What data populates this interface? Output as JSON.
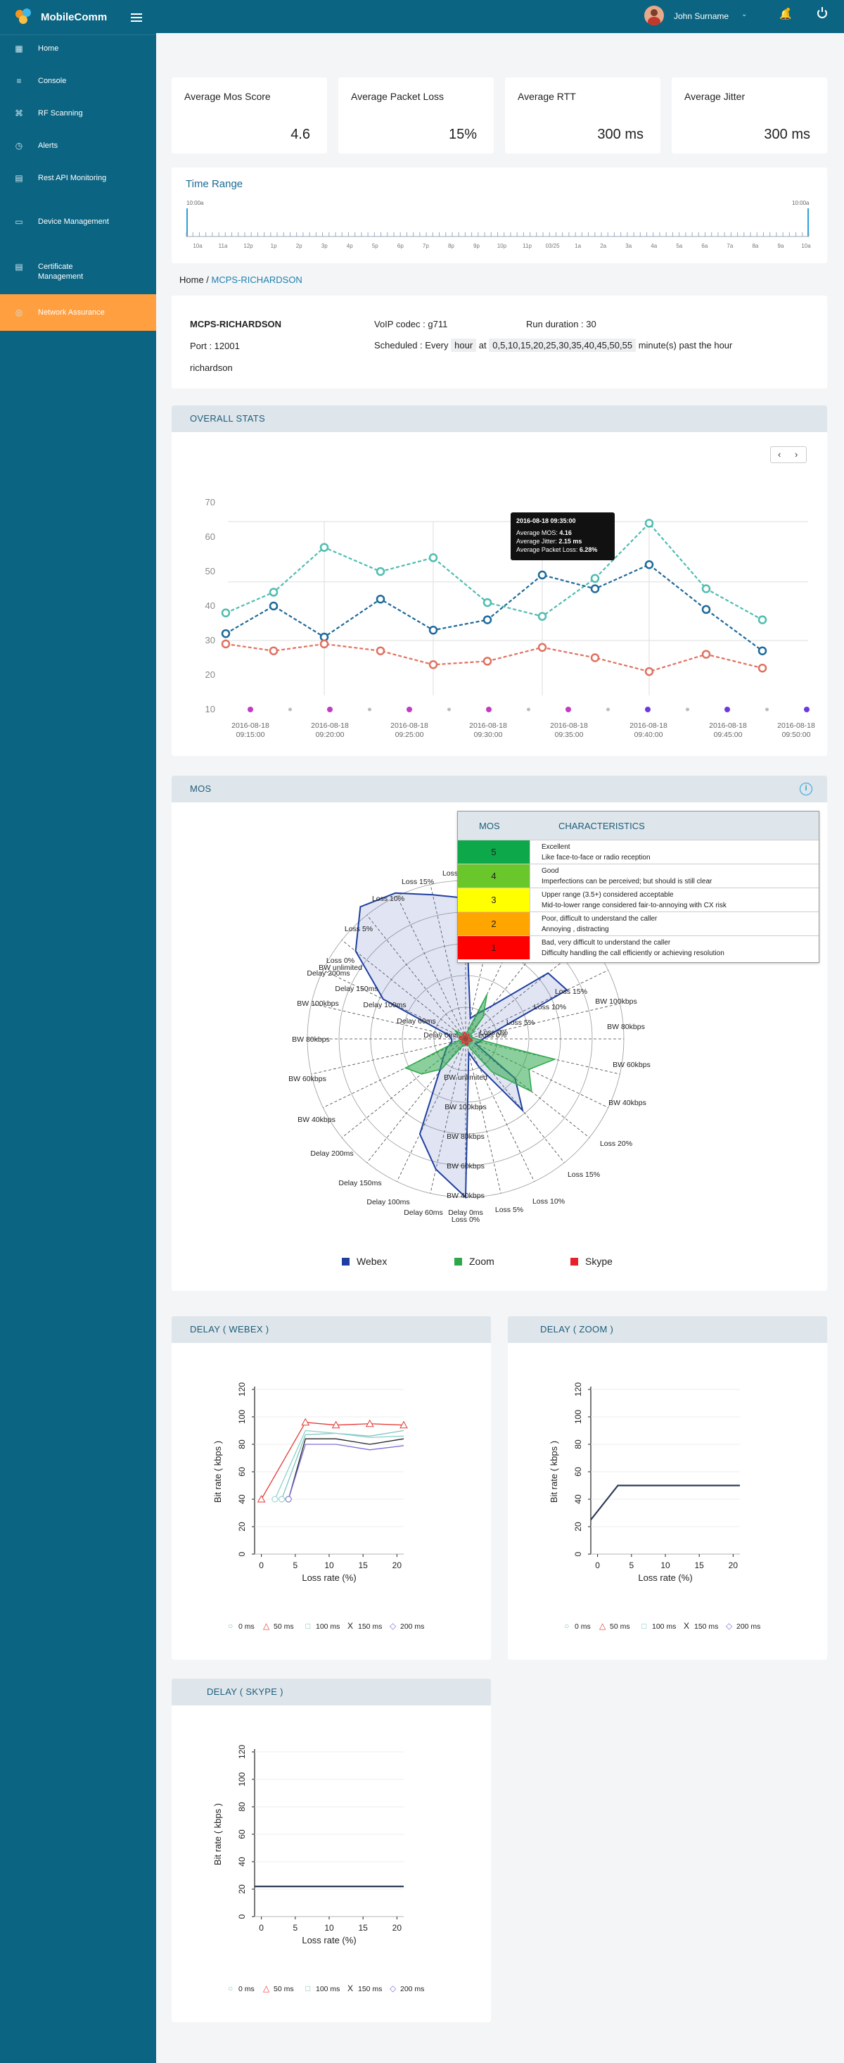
{
  "app": {
    "name": "MobileComm"
  },
  "sidebar": {
    "items": [
      {
        "label": "Home",
        "icon": "dashboard-icon"
      },
      {
        "label": "Console",
        "icon": "sliders-icon"
      },
      {
        "label": "RF Scanning",
        "icon": "tools-icon"
      },
      {
        "label": "Alerts",
        "icon": "clock-icon"
      },
      {
        "label": "Rest API Monitoring",
        "icon": "api-icon"
      },
      {
        "label": "Device Management",
        "icon": "device-icon"
      },
      {
        "label": "Certificate Management",
        "icon": "certificate-icon"
      },
      {
        "label": "Network Assurance",
        "icon": "network-icon"
      }
    ]
  },
  "topbar": {
    "user": "John Surname"
  },
  "kpis": [
    {
      "label": "Average Mos Score",
      "value": "4.6"
    },
    {
      "label": "Average Packet Loss",
      "value": "15%"
    },
    {
      "label": "Average RTT",
      "value": "300 ms"
    },
    {
      "label": "Average Jitter",
      "value": "300 ms"
    }
  ],
  "timerange": {
    "title": "Time Range",
    "start": "10:00a",
    "end": "10:00a",
    "ticks": [
      "10a",
      "11a",
      "12p",
      "1p",
      "2p",
      "3p",
      "4p",
      "5p",
      "6p",
      "7p",
      "8p",
      "9p",
      "10p",
      "11p",
      "03/25",
      "1a",
      "2a",
      "3a",
      "4a",
      "5a",
      "6a",
      "7a",
      "8a",
      "9a",
      "10a"
    ]
  },
  "breadcrumb": {
    "home": "Home",
    "current": "MCPS-RICHARDSON"
  },
  "info": {
    "name": "MCPS-RICHARDSON",
    "port": "Port : 12001",
    "location": "richardson",
    "codec": "VoIP codec : g711",
    "run": "Run duration : 30",
    "sched_prefix": "Scheduled : Every",
    "sched_unit": "hour",
    "sched_at": "at",
    "sched_minutes": "0,5,10,15,20,25,30,35,40,45,50,55",
    "sched_suffix": "minute(s) past the hour"
  },
  "overall": {
    "title": "OVERALL STATS",
    "tooltip": {
      "time": "2016-08-18    09:35:00",
      "mos_label": "Average MOS:",
      "mos": "4.16",
      "jitter_label": "Average Jitter:",
      "jitter": "2.15 ms",
      "loss_label": "Average Packet Loss:",
      "loss": "6.28%"
    }
  },
  "mos": {
    "title": "MOS",
    "col1": "MOS",
    "col2": "CHARACTERISTICS",
    "rows": [
      {
        "score": "5",
        "color": "#0ca84a",
        "l1": "Excellent",
        "l2": "Like face-to-face or radio reception"
      },
      {
        "score": "4",
        "color": "#6ac72b",
        "l1": "Good",
        "l2": "Imperfections can be perceived; but should is still  clear"
      },
      {
        "score": "3",
        "color": "#ffff00",
        "l1": "Upper range (3.5+) considered acceptable",
        "l2": "Mid-to-lower range considered fair-to-annoying with CX risk"
      },
      {
        "score": "2",
        "color": "#ffa500",
        "l1": "Poor, difficult to understand the caller",
        "l2": "Annoying , distracting"
      },
      {
        "score": "1",
        "color": "#ff0000",
        "l1": "Bad, very difficult to understand the caller",
        "l2": "Difficulty handling the call efficiently or achieving resolution"
      }
    ],
    "legend": [
      {
        "name": "Webex",
        "color": "#1f3fa0"
      },
      {
        "name": "Zoom",
        "color": "#2ca84a"
      },
      {
        "name": "Skype",
        "color": "#e8202a"
      }
    ]
  },
  "delay_panels": {
    "webex": "DELAY ( WEBEX )",
    "zoom": "DELAY ( ZOOM )",
    "skype": "DELAY ( SKYPE )",
    "xlabel": "Loss rate (%)",
    "ylabel": "Bit rate ( kbps )",
    "legend": [
      "0 ms",
      "50 ms",
      "100 ms",
      "150 ms",
      "200 ms"
    ]
  },
  "chart_data": [
    {
      "type": "line",
      "x": [
        "2016-08-18 09:15:00",
        "2016-08-18 09:20:00",
        "2016-08-18 09:25:00",
        "2016-08-18 09:30:00",
        "2016-08-18 09:35:00",
        "2016-08-18 09:40:00",
        "2016-08-18 09:45:00",
        "2016-08-18 09:50:00"
      ],
      "ylim": [
        10,
        70
      ],
      "yticks": [
        10,
        20,
        30,
        40,
        50,
        60,
        70
      ],
      "series": [
        {
          "color": "#4fbdb0",
          "values": [
            38,
            44,
            57,
            50,
            54,
            41,
            37,
            48,
            64,
            45,
            36
          ]
        },
        {
          "color": "#1d6a9a",
          "values": [
            32,
            40,
            31,
            42,
            33,
            36,
            49,
            45,
            52,
            39,
            27
          ]
        },
        {
          "color": "#e07160",
          "values": [
            29,
            27,
            29,
            27,
            23,
            24,
            28,
            25,
            21,
            26,
            22
          ]
        }
      ],
      "pts_x": [
        0,
        1,
        2,
        3,
        4,
        5,
        6,
        7,
        8,
        9,
        10
      ]
    },
    {
      "type": "radar",
      "axes": [
        "Loss 0%",
        "Loss 5%",
        "Loss 10%",
        "Loss 15%",
        "Loss 20%",
        "BW 100kbps",
        "BW 80kbps",
        "BW 60kbps",
        "BW 40kbps",
        "Delay 200ms",
        "Delay 150ms",
        "Delay 100ms",
        "Delay 60ms",
        "Delay 0ms",
        "Loss 0%",
        "Loss 5%",
        "Loss 10%",
        "Loss 15%",
        "Loss 20%",
        "BW 100kbps",
        "BW 80kbps",
        "BW 60kbps",
        "BW 40kbps",
        "Delay 200ms",
        "Delay 150ms",
        "Delay 100ms",
        "Delay 60ms",
        "Delay 0ms"
      ],
      "series": [
        {
          "name": "Webex"
        },
        {
          "name": "Zoom"
        },
        {
          "name": "Skype"
        }
      ]
    },
    {
      "type": "line",
      "title": "DELAY ( WEBEX )",
      "x": [
        0,
        2,
        3,
        4,
        6.5,
        11,
        16,
        21
      ],
      "ylim": [
        0,
        120
      ],
      "xlim": [
        -1,
        21
      ],
      "series": [
        {
          "name": "0 ms",
          "values": [
            null,
            null,
            40,
            null,
            87,
            88,
            86,
            90
          ]
        },
        {
          "name": "50 ms",
          "values": [
            40,
            null,
            null,
            null,
            96,
            94,
            95,
            94
          ]
        },
        {
          "name": "100 ms",
          "values": [
            null,
            40,
            null,
            null,
            90,
            88,
            85,
            86
          ]
        },
        {
          "name": "150 ms",
          "values": [
            null,
            null,
            null,
            40,
            84,
            84,
            80,
            84
          ]
        },
        {
          "name": "200 ms",
          "values": [
            null,
            null,
            null,
            40,
            80,
            80,
            76,
            79
          ]
        }
      ]
    },
    {
      "type": "line",
      "title": "DELAY ( ZOOM )",
      "x": [
        -1,
        3,
        21
      ],
      "ylim": [
        0,
        120
      ],
      "xlim": [
        -1,
        21
      ],
      "series": [
        {
          "values": [
            25,
            50,
            50
          ]
        }
      ]
    },
    {
      "type": "line",
      "title": "DELAY ( SKYPE )",
      "x": [
        -1,
        21
      ],
      "ylim": [
        0,
        120
      ],
      "xlim": [
        -1,
        21
      ],
      "series": [
        {
          "values": [
            22,
            22
          ]
        }
      ]
    }
  ]
}
